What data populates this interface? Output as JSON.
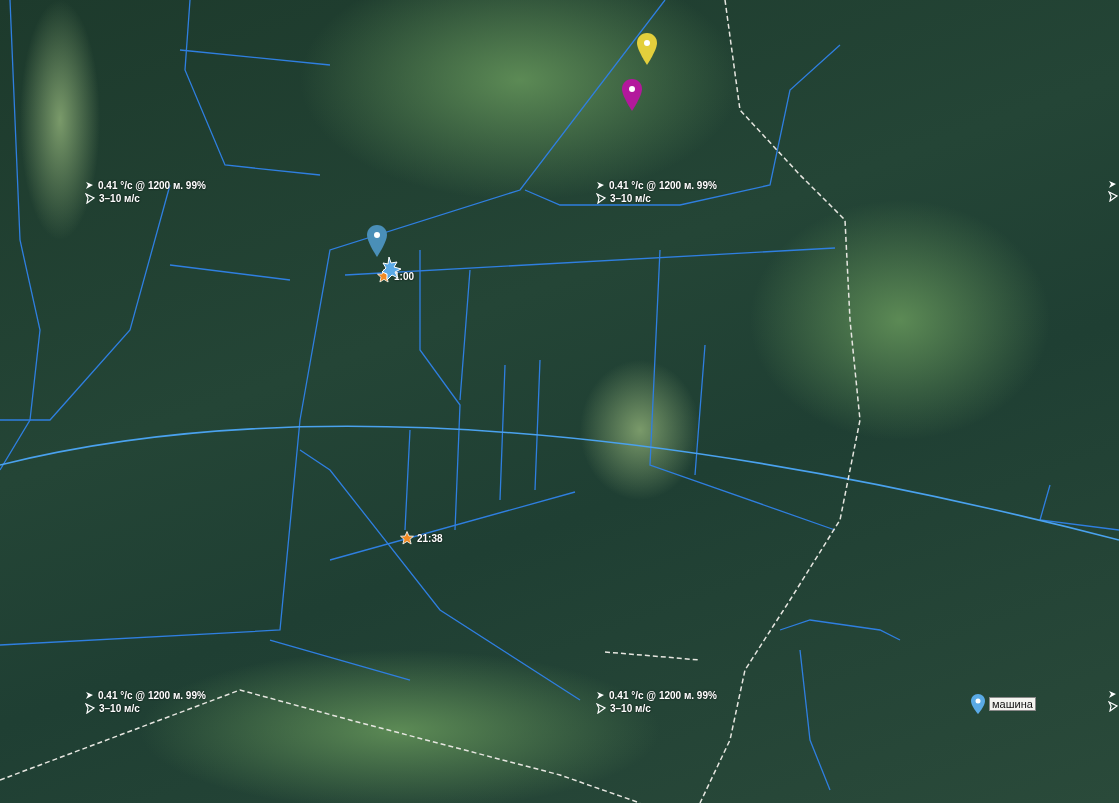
{
  "weather_labels": [
    {
      "wind": "0.41 °/c @ 1200 м. 99%",
      "gust": "3–10 м/с"
    },
    {
      "wind": "0.41 °/c @ 1200 м. 99%",
      "gust": "3–10 м/с"
    },
    {
      "wind": "0.41 °/c @ 1200 м. 99%",
      "gust": "3–10 м/с"
    },
    {
      "wind": "0.41 °/c @ 1200 м. 99%",
      "gust": "3–10 м/с"
    }
  ],
  "pins": [
    {
      "color": "#e3cf3c"
    },
    {
      "color": "#b3189c"
    },
    {
      "color": "#4a8fb8"
    }
  ],
  "track_points": [
    {
      "time": "1:00"
    },
    {
      "time": "21:38"
    }
  ],
  "vehicle": {
    "label": "машина"
  }
}
